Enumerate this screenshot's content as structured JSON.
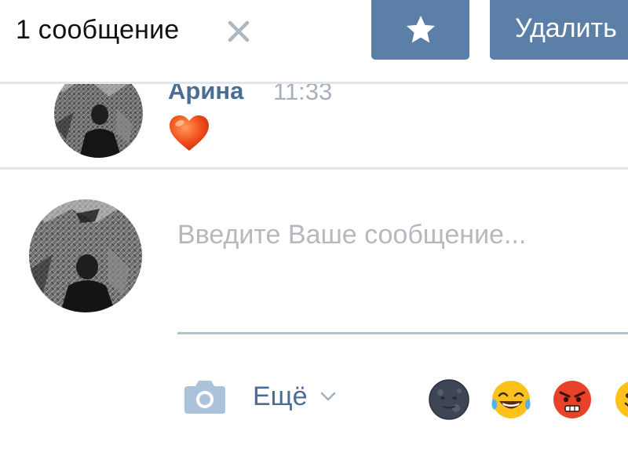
{
  "selection_bar": {
    "count_label": "1 сообщение",
    "delete_label": "Удалить"
  },
  "message": {
    "author": "Арина",
    "time": "11:33",
    "content_emoji": "red-heart"
  },
  "composer": {
    "placeholder": "Введите Ваше сообщение...",
    "value": "",
    "more_label": "Ещё",
    "quick_emojis": [
      "new-moon-face",
      "tears-of-joy",
      "angry-face",
      "smiling-face"
    ]
  },
  "colors": {
    "button_bg": "#5b7fa6",
    "link": "#4a6d96",
    "muted": "#a8b0b9",
    "divider": "#e3e6ea",
    "placeholder": "#b5b9be"
  }
}
